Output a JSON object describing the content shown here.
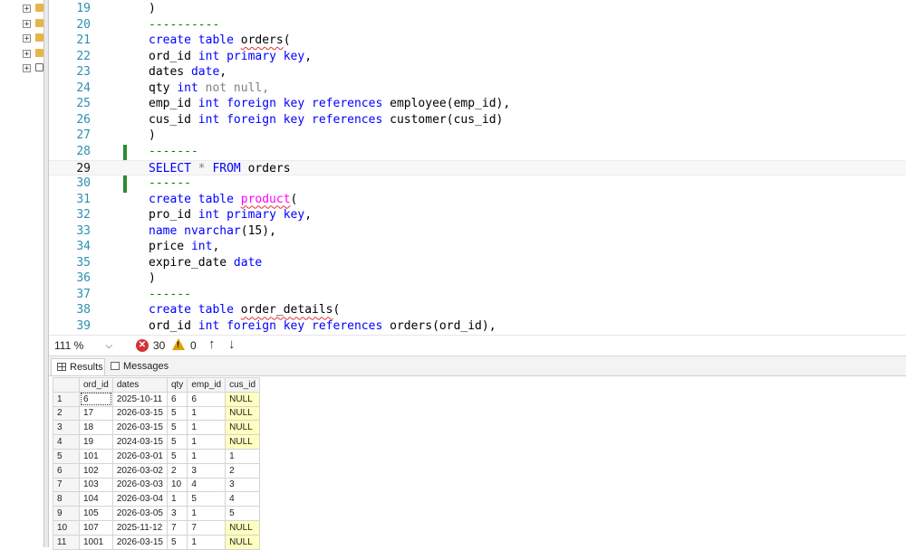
{
  "explorer": {
    "nodes": 5
  },
  "editor": {
    "current_line": "29",
    "lines": [
      {
        "n": "19",
        "tokens": [
          {
            "t": ")",
            "c": ""
          }
        ]
      },
      {
        "n": "20",
        "tokens": [
          {
            "t": "----------",
            "c": "cm"
          }
        ]
      },
      {
        "n": "21",
        "tokens": [
          {
            "t": "create table ",
            "c": "kw"
          },
          {
            "t": "orders",
            "c": "sq"
          },
          {
            "t": "(",
            "c": ""
          }
        ]
      },
      {
        "n": "22",
        "tokens": [
          {
            "t": "ord_id ",
            "c": ""
          },
          {
            "t": "int primary key",
            "c": "kw"
          },
          {
            "t": ",",
            "c": ""
          }
        ]
      },
      {
        "n": "23",
        "tokens": [
          {
            "t": "dates ",
            "c": ""
          },
          {
            "t": "date",
            "c": "kw"
          },
          {
            "t": ",",
            "c": ""
          }
        ]
      },
      {
        "n": "24",
        "tokens": [
          {
            "t": "qty ",
            "c": ""
          },
          {
            "t": "int",
            "c": "kw"
          },
          {
            "t": " not null,",
            "c": "kw2"
          }
        ]
      },
      {
        "n": "25",
        "tokens": [
          {
            "t": "emp_id ",
            "c": ""
          },
          {
            "t": "int foreign key references",
            "c": "kw"
          },
          {
            "t": " employee(emp_id),",
            "c": ""
          }
        ]
      },
      {
        "n": "26",
        "tokens": [
          {
            "t": "cus_id ",
            "c": ""
          },
          {
            "t": "int foreign key references",
            "c": "kw"
          },
          {
            "t": " customer(cus_id)",
            "c": ""
          }
        ]
      },
      {
        "n": "27",
        "tokens": [
          {
            "t": ")",
            "c": ""
          }
        ]
      },
      {
        "n": "28",
        "tokens": [
          {
            "t": "-------",
            "c": "cm"
          }
        ]
      },
      {
        "n": "29",
        "tokens": [
          {
            "t": "SELECT",
            "c": "kw"
          },
          {
            "t": " * ",
            "c": "kw2"
          },
          {
            "t": "FROM",
            "c": "kw"
          },
          {
            "t": " orders",
            "c": ""
          }
        ]
      },
      {
        "n": "30",
        "tokens": [
          {
            "t": "------",
            "c": "cm"
          }
        ]
      },
      {
        "n": "31",
        "tokens": [
          {
            "t": "create table ",
            "c": "kw"
          },
          {
            "t": "product",
            "c": "fn sq"
          },
          {
            "t": "(",
            "c": ""
          }
        ]
      },
      {
        "n": "32",
        "tokens": [
          {
            "t": "pro_id ",
            "c": ""
          },
          {
            "t": "int primary key",
            "c": "kw"
          },
          {
            "t": ",",
            "c": ""
          }
        ]
      },
      {
        "n": "33",
        "tokens": [
          {
            "t": "name ",
            "c": "kw"
          },
          {
            "t": "nvarchar",
            "c": "kw"
          },
          {
            "t": "(15),",
            "c": ""
          }
        ]
      },
      {
        "n": "34",
        "tokens": [
          {
            "t": "price ",
            "c": ""
          },
          {
            "t": "int",
            "c": "kw"
          },
          {
            "t": ",",
            "c": ""
          }
        ]
      },
      {
        "n": "35",
        "tokens": [
          {
            "t": "expire_date ",
            "c": ""
          },
          {
            "t": "date",
            "c": "kw"
          }
        ]
      },
      {
        "n": "36",
        "tokens": [
          {
            "t": ")",
            "c": ""
          }
        ]
      },
      {
        "n": "37",
        "tokens": [
          {
            "t": "------",
            "c": "cm"
          }
        ]
      },
      {
        "n": "38",
        "tokens": [
          {
            "t": "create table ",
            "c": "kw"
          },
          {
            "t": "order_details",
            "c": "sq"
          },
          {
            "t": "(",
            "c": ""
          }
        ]
      },
      {
        "n": "39",
        "tokens": [
          {
            "t": "ord_id ",
            "c": ""
          },
          {
            "t": "int foreign key references",
            "c": "kw"
          },
          {
            "t": " orders(ord_id),",
            "c": ""
          }
        ]
      }
    ]
  },
  "statusbar": {
    "zoom": "111 %",
    "zoom_chevron": "⌵",
    "error_icon": "✕",
    "errors": "30",
    "warning_icon": "!",
    "warnings": "0",
    "up": "↑",
    "down": "↓"
  },
  "tabs": {
    "results": "Results",
    "messages": "Messages"
  },
  "grid": {
    "columns": [
      "ord_id",
      "dates",
      "qty",
      "emp_id",
      "cus_id"
    ],
    "rows": [
      [
        "1",
        "6",
        "2025-10-11",
        "6",
        "6",
        "NULL"
      ],
      [
        "2",
        "17",
        "2026-03-15",
        "5",
        "1",
        "NULL"
      ],
      [
        "3",
        "18",
        "2026-03-15",
        "5",
        "1",
        "NULL"
      ],
      [
        "4",
        "19",
        "2024-03-15",
        "5",
        "1",
        "NULL"
      ],
      [
        "5",
        "101",
        "2026-03-01",
        "5",
        "1",
        "1"
      ],
      [
        "6",
        "102",
        "2026-03-02",
        "2",
        "3",
        "2"
      ],
      [
        "7",
        "103",
        "2026-03-03",
        "10",
        "4",
        "3"
      ],
      [
        "8",
        "104",
        "2026-03-04",
        "1",
        "5",
        "4"
      ],
      [
        "9",
        "105",
        "2026-03-05",
        "3",
        "1",
        "5"
      ],
      [
        "10",
        "107",
        "2025-11-12",
        "7",
        "7",
        "NULL"
      ],
      [
        "11",
        "1001",
        "2026-03-15",
        "5",
        "1",
        "NULL"
      ]
    ]
  }
}
